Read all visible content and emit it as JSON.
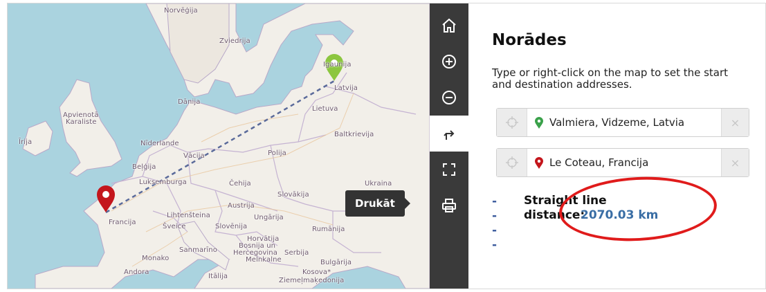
{
  "map": {
    "labels": [
      {
        "id": "norvegija",
        "text": "Norvēģija"
      },
      {
        "id": "zviedrija",
        "text": "Zviedrija"
      },
      {
        "id": "igaunija",
        "text": "Igaunija"
      },
      {
        "id": "latvija",
        "text": "Latvija"
      },
      {
        "id": "danija",
        "text": "Dānija"
      },
      {
        "id": "lietuva",
        "text": "Lietuva"
      },
      {
        "id": "apvienota",
        "text": "Apvienotā"
      },
      {
        "id": "karaliste",
        "text": "Karaliste"
      },
      {
        "id": "baltkrievija",
        "text": "Baltkrievija"
      },
      {
        "id": "irija",
        "text": "Īrija"
      },
      {
        "id": "niderlande",
        "text": "Nīderlande"
      },
      {
        "id": "vacija",
        "text": "Vācija"
      },
      {
        "id": "polija",
        "text": "Polija"
      },
      {
        "id": "belgija",
        "text": "Beļģija"
      },
      {
        "id": "luksemburga",
        "text": "Luksemburga"
      },
      {
        "id": "cehija",
        "text": "Čehija"
      },
      {
        "id": "slovakija",
        "text": "Slovākija"
      },
      {
        "id": "ukraina",
        "text": "Ukraina"
      },
      {
        "id": "austrija",
        "text": "Austrija"
      },
      {
        "id": "lihtensteina",
        "text": "Lihtenšteina"
      },
      {
        "id": "francija",
        "text": "Francija"
      },
      {
        "id": "ungarija",
        "text": "Ungārija"
      },
      {
        "id": "sveice",
        "text": "Šveice"
      },
      {
        "id": "slovenija",
        "text": "Slovēnija"
      },
      {
        "id": "rumanija",
        "text": "Rumānija"
      },
      {
        "id": "horvatija",
        "text": "Horvātija"
      },
      {
        "id": "bosnija1",
        "text": "Bosnija un"
      },
      {
        "id": "bosnija2",
        "text": "Hercegovina"
      },
      {
        "id": "serbija",
        "text": "Serbija"
      },
      {
        "id": "sanmarino",
        "text": "Sanmarīno"
      },
      {
        "id": "monako",
        "text": "Monako"
      },
      {
        "id": "melnkalne",
        "text": "Melnkalne"
      },
      {
        "id": "bulgarija",
        "text": "Bulgārija"
      },
      {
        "id": "andora",
        "text": "Andora"
      },
      {
        "id": "kosova",
        "text": "Kosova*"
      },
      {
        "id": "italija",
        "text": "Itālija"
      },
      {
        "id": "ziemelmakedonija",
        "text": "Ziemeļmaķedonija"
      }
    ],
    "start_marker_color": "#8cc63f",
    "end_marker_color": "#c4161c",
    "route_color": "#5a6a9a"
  },
  "toolbar": {
    "buttons": [
      {
        "name": "home-button",
        "icon": "home-icon"
      },
      {
        "name": "zoom-in-button",
        "icon": "plus-circle-icon"
      },
      {
        "name": "zoom-out-button",
        "icon": "minus-circle-icon"
      },
      {
        "name": "directions-button",
        "icon": "directions-icon"
      },
      {
        "name": "fullscreen-button",
        "icon": "fullscreen-icon"
      },
      {
        "name": "print-button",
        "icon": "print-icon"
      }
    ],
    "tooltip": "Drukāt"
  },
  "panel": {
    "title": "Norādes",
    "description": "Type or right-click on the map to set the start and destination addresses.",
    "start_address": "Valmiera, Vidzeme, Latvia",
    "destination_address": "Le Coteau, Francija",
    "start_pin_color": "#3aa14a",
    "destination_pin_color": "#c4161c",
    "clear_symbol": "×",
    "distance_dash": "----",
    "distance_label": "Straight line distance:",
    "distance_value": "2070.03 km",
    "highlight_color": "#e01b1b"
  }
}
